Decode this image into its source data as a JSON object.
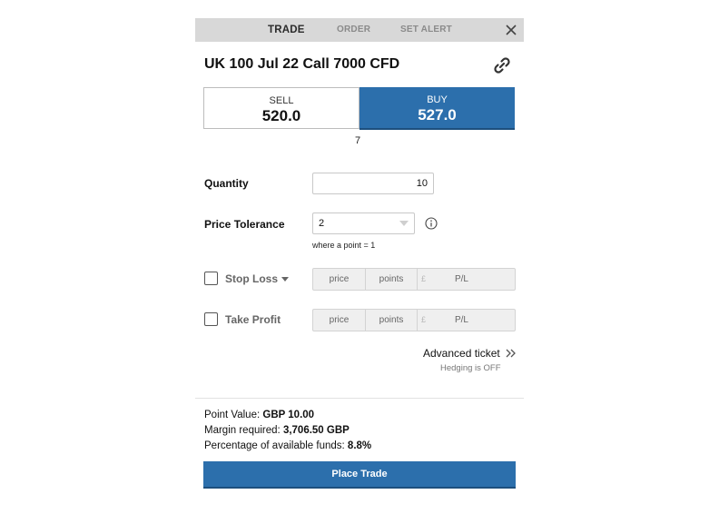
{
  "tabs": [
    {
      "label": "TRADE",
      "active": true
    },
    {
      "label": "ORDER",
      "active": false
    },
    {
      "label": "SET ALERT",
      "active": false
    }
  ],
  "ticket": {
    "title": "UK 100 Jul 22 Call 7000 CFD",
    "sell": {
      "label": "SELL",
      "price": "520.0"
    },
    "buy": {
      "label": "BUY",
      "price": "527.0"
    },
    "spread": "7"
  },
  "form": {
    "quantity_label": "Quantity",
    "quantity_value": "10",
    "tolerance_label": "Price Tolerance",
    "tolerance_value": "2",
    "tolerance_hint": "where a point = 1",
    "stop_loss": {
      "label": "Stop Loss",
      "checked": false,
      "price": "price",
      "points": "points",
      "currency": "£",
      "pl": "P/L"
    },
    "take_profit": {
      "label": "Take Profit",
      "checked": false,
      "price": "price",
      "points": "points",
      "currency": "£",
      "pl": "P/L"
    }
  },
  "advanced": {
    "label": "Advanced ticket",
    "hedging": "Hedging is OFF"
  },
  "summary": {
    "point_value_label": "Point Value:",
    "point_value": "GBP 10.00",
    "margin_label": "Margin required:",
    "margin": "3,706.50 GBP",
    "funds_label": "Percentage of available funds:",
    "funds": "8.8%"
  },
  "place_trade": "Place Trade",
  "colors": {
    "accent": "#2c6fac",
    "tabbar": "#d8d8d8"
  },
  "icons": [
    "close-icon",
    "link-icon",
    "info-icon",
    "chevron-double-right-icon",
    "dropdown-arrow-icon"
  ]
}
